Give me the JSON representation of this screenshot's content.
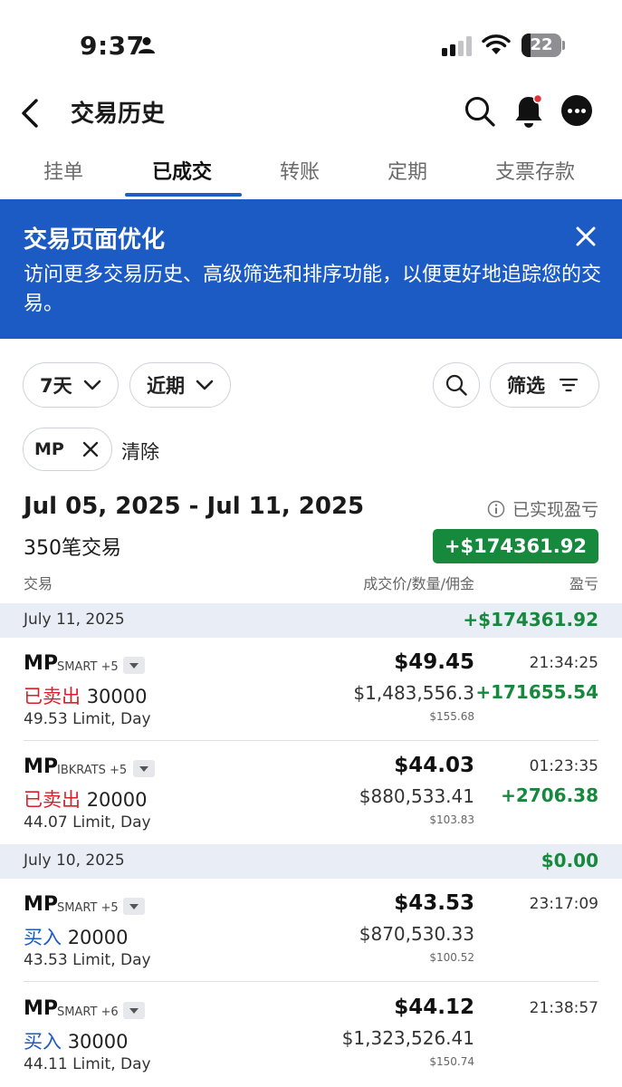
{
  "status_bar": {
    "time": "9:37",
    "battery": "22",
    "battery_level": 0.22
  },
  "header": {
    "title": "交易历史"
  },
  "tabs": [
    {
      "label": "挂单",
      "active": false
    },
    {
      "label": "已成交",
      "active": true
    },
    {
      "label": "转账",
      "active": false
    },
    {
      "label": "定期",
      "active": false
    },
    {
      "label": "支票存款",
      "active": false
    }
  ],
  "banner": {
    "title": "交易页面优化",
    "body": "访问更多交易历史、高级筛选和排序功能，以便更好地追踪您的交易。"
  },
  "filters": {
    "period": "7天",
    "sort": "近期",
    "filter_label": "筛选",
    "symbol_chip": "MP",
    "clear_label": "清除"
  },
  "summary": {
    "date_range": "Jul 05, 2025 - Jul 11, 2025",
    "count_label": "350笔交易",
    "realized_label": "已实现盈亏",
    "total_pnl": "+$174361.92",
    "col_trade": "交易",
    "col_price": "成交价/数量/佣金",
    "col_pnl": "盈亏"
  },
  "groups": [
    {
      "date": "July 11, 2025",
      "pnl": "+$174361.92",
      "trades": [
        {
          "symbol": "MP",
          "exchange": "SMART +5",
          "side": "已卖出",
          "side_type": "sell",
          "qty": "30000",
          "order": "49.53 Limit, Day",
          "price": "$49.45",
          "amount": "$1,483,556.3",
          "commission": "$155.68",
          "time": "21:34:25",
          "pnl": "+171655.54"
        },
        {
          "symbol": "MP",
          "exchange": "IBKRATS +5",
          "side": "已卖出",
          "side_type": "sell",
          "qty": "20000",
          "order": "44.07 Limit, Day",
          "price": "$44.03",
          "amount": "$880,533.41",
          "commission": "$103.83",
          "time": "01:23:35",
          "pnl": "+2706.38"
        }
      ]
    },
    {
      "date": "July 10, 2025",
      "pnl": "$0.00",
      "trades": [
        {
          "symbol": "MP",
          "exchange": "SMART +5",
          "side": "买入",
          "side_type": "buy",
          "qty": "20000",
          "order": "43.53 Limit, Day",
          "price": "$43.53",
          "amount": "$870,530.33",
          "commission": "$100.52",
          "time": "23:17:09",
          "pnl": ""
        },
        {
          "symbol": "MP",
          "exchange": "SMART +6",
          "side": "买入",
          "side_type": "buy",
          "qty": "30000",
          "order": "44.11 Limit, Day",
          "price": "$44.12",
          "amount": "$1,323,526.41",
          "commission": "$150.74",
          "time": "21:38:57",
          "pnl": ""
        }
      ]
    }
  ],
  "colors": {
    "accent": "#1d5bc4",
    "positive": "#16893d",
    "sell": "#d6202a",
    "group_bg": "#e9eef6"
  }
}
